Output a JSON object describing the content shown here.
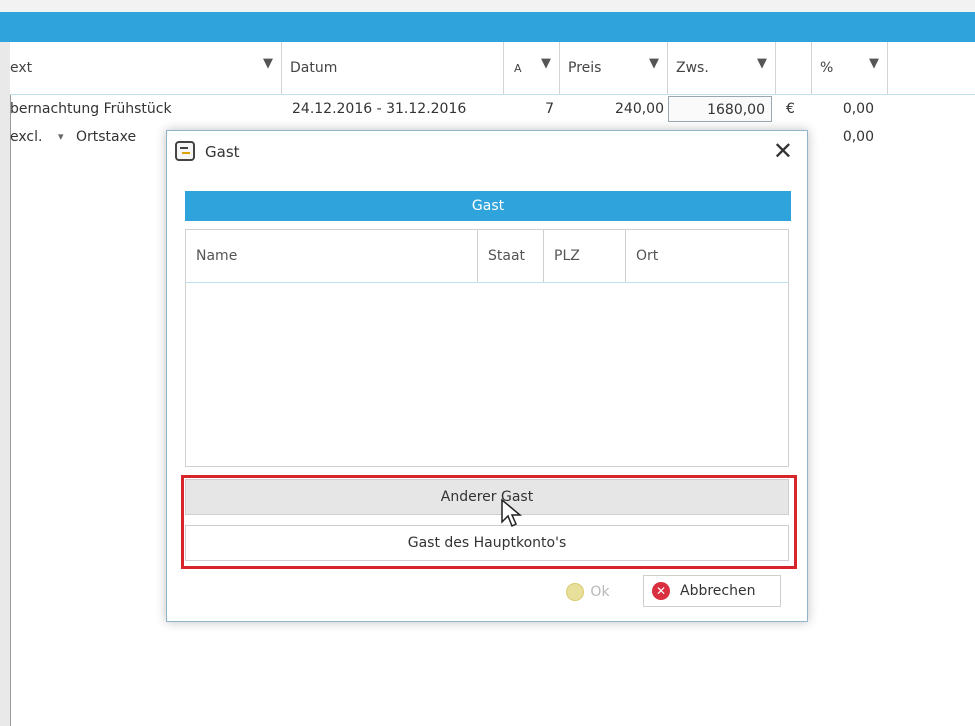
{
  "grid": {
    "columns": [
      {
        "label": "ext",
        "filter_icon": "filter-icon"
      },
      {
        "label": "Datum"
      },
      {
        "label": "A"
      },
      {
        "label": "Preis"
      },
      {
        "label": "Zws."
      },
      {
        "label": ""
      },
      {
        "label": "%"
      }
    ],
    "rows": [
      {
        "text": "bernachtung Frühstück",
        "datum": "24.12.2016 - 31.12.2016",
        "anzahl": "7",
        "preis": "240,00",
        "zws": "1680,00",
        "currency": "€",
        "percent": "0,00"
      },
      {
        "text": "excl.",
        "dropdown_icon": "▾",
        "type": "Ortstaxe",
        "percent": "0,00"
      }
    ]
  },
  "dialog": {
    "title": "Gast",
    "section_title": "Gast",
    "columns": [
      "Name",
      "Staat",
      "PLZ",
      "Ort"
    ],
    "btn_other_guest": "Anderer Gast",
    "btn_main_account_guest": "Gast des Hauptkonto's",
    "btn_ok": "Ok",
    "btn_cancel": "Abbrechen",
    "close_glyph": "✕"
  },
  "colors": {
    "accent": "#2ea3dc",
    "highlight": "#d7262b",
    "cancel_icon": "#d92f3f"
  }
}
